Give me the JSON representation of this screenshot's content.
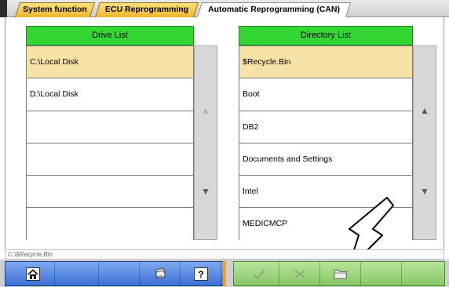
{
  "tabs": [
    {
      "label": "System function"
    },
    {
      "label": "ECU Reprogramming"
    },
    {
      "label": "Automatic Reprogramming (CAN)"
    }
  ],
  "drive_list": {
    "title": "Drive List",
    "items": [
      "C:\\Local Disk",
      "D:\\Local Disk",
      "",
      "",
      "",
      ""
    ],
    "selected_index": 0
  },
  "directory_list": {
    "title": "Directory List",
    "items": [
      "$Recycle.Bin",
      "Boot",
      "DB2",
      "Documents and Settings",
      "Intel",
      "MEDICMCP"
    ],
    "selected_index": 0
  },
  "status_path": "C:\\$Recycle.Bin",
  "toolbar": {
    "left_buttons": [
      "home-icon",
      "blank",
      "blank",
      "print-icon",
      "help-icon"
    ],
    "right_buttons": [
      "check-icon",
      "cross-icon",
      "folder-icon",
      "blank",
      "blank"
    ]
  },
  "colors": {
    "list_header": "#33d633",
    "selected_row": "#f7e3a6",
    "tab_orange": "#f0b52a",
    "toolbar_blue": "#3d70d6",
    "toolbar_green": "#86c766"
  }
}
